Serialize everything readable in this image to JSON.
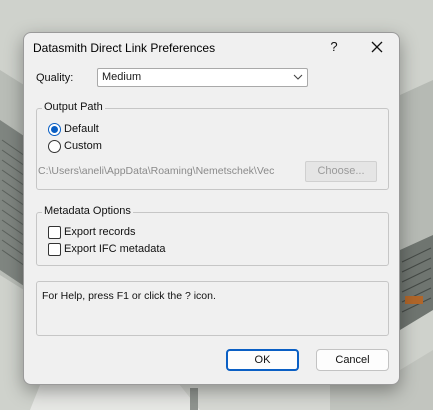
{
  "dialog": {
    "title": "Datasmith Direct Link Preferences",
    "help_glyph": "?",
    "quality_label": "Quality:",
    "quality_value": "Medium",
    "output_path": {
      "legend": "Output Path",
      "option_default": "Default",
      "option_custom": "Custom",
      "selected": "Default",
      "path_value": "C:\\Users\\aneli\\AppData\\Roaming\\Nemetschek\\Vec",
      "choose_label": "Choose..."
    },
    "metadata": {
      "legend": "Metadata Options",
      "export_records": "Export records",
      "export_ifc": "Export IFC metadata",
      "export_records_checked": false,
      "export_ifc_checked": false
    },
    "help_text": "For Help, press F1 or click the ? icon.",
    "ok_label": "OK",
    "cancel_label": "Cancel"
  },
  "colors": {
    "accent": "#0a5fc4",
    "dialog_bg": "#f0f0f0",
    "background_scene": "#c8cbc5"
  }
}
